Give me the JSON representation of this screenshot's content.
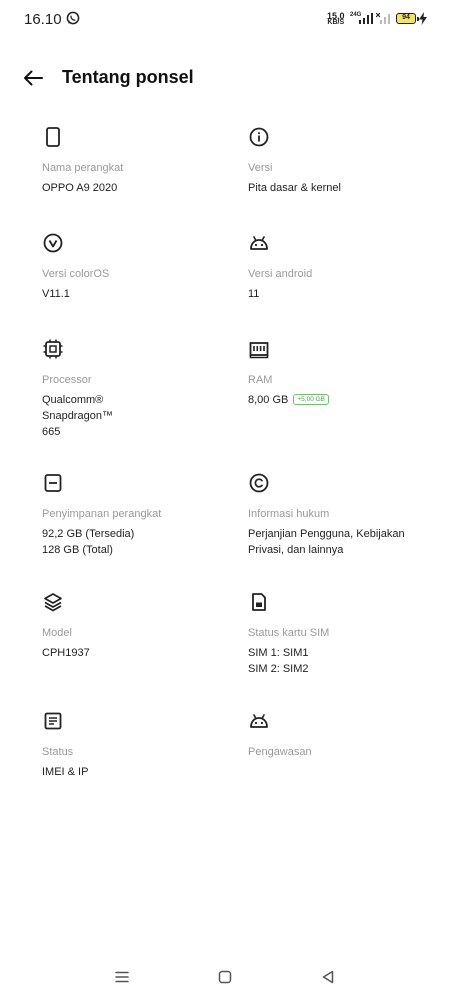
{
  "status_bar": {
    "time": "16.10",
    "net_speed_value": "15,0",
    "net_speed_unit": "KB/S",
    "network_type": "24G",
    "battery_level": "94",
    "icons": [
      "whatsapp-icon",
      "signal-icon",
      "signal-icon",
      "charging-bolt-icon"
    ]
  },
  "header": {
    "title": "Tentang ponsel",
    "back_icon": "arrow-left-icon"
  },
  "items": [
    {
      "icon": "phone-icon",
      "label": "Nama perangkat",
      "value": "OPPO A9 2020"
    },
    {
      "icon": "info-icon",
      "label": "Versi",
      "value": "Pita dasar & kernel"
    },
    {
      "icon": "coloros-icon",
      "label": "Versi colorOS",
      "value": "V11.1"
    },
    {
      "icon": "android-icon",
      "label": "Versi android",
      "value": "11"
    },
    {
      "icon": "processor-icon",
      "label": "Processor",
      "value": "Qualcomm®\nSnapdragon™\n665"
    },
    {
      "icon": "ram-icon",
      "label": "RAM",
      "value": "8,00 GB",
      "badge": "+5,00 GB"
    },
    {
      "icon": "storage-icon",
      "label": "Penyimpanan perangkat",
      "value": "92,2 GB (Tersedia)\n128 GB (Total)"
    },
    {
      "icon": "copyright-icon",
      "label": "Informasi hukum",
      "value": "Perjanjian Pengguna, Kebijakan\nPrivasi, dan lainnya"
    },
    {
      "icon": "layers-icon",
      "label": "Model",
      "value": "CPH1937"
    },
    {
      "icon": "sim-card-icon",
      "label": "Status kartu SIM",
      "value": "SIM 1: SIM1\nSIM 2: SIM2"
    },
    {
      "icon": "document-icon",
      "label": "Status",
      "value": "IMEI & IP"
    },
    {
      "icon": "android-icon",
      "label": "Pengawasan",
      "value": ""
    }
  ],
  "nav_bar": {
    "icons": [
      "menu-icon",
      "home-icon",
      "back-triangle-icon"
    ]
  },
  "colors": {
    "text_primary": "#1f1f1f",
    "text_secondary": "#9a9a9a",
    "badge_green": "#4aa845",
    "battery_fill": "#f2e36a"
  }
}
